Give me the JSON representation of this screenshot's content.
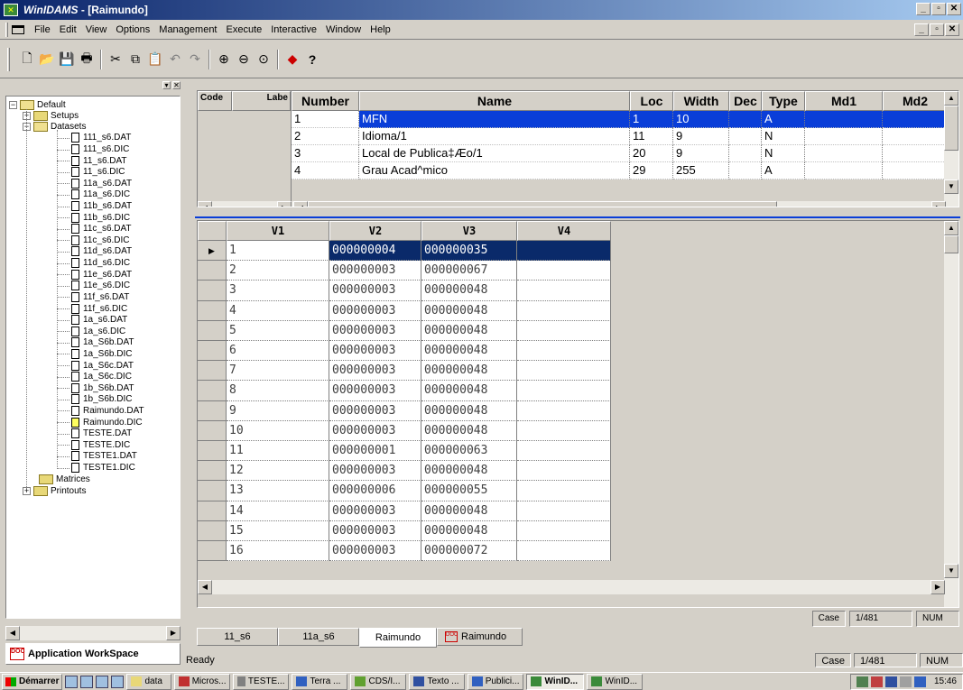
{
  "window": {
    "title_app": "WinIDAMS",
    "title_doc": " - [Raimundo]"
  },
  "menu": [
    "File",
    "Edit",
    "View",
    "Options",
    "Management",
    "Execute",
    "Interactive",
    "Window",
    "Help"
  ],
  "toolbar": [
    "new-icon",
    "open-icon",
    "save-icon",
    "print-icon",
    "cut-icon",
    "copy-icon",
    "paste-icon",
    "undo-icon",
    "redo-icon",
    "zoom-in-icon",
    "zoom-out-icon",
    "zoom-reset-icon",
    "diamond-icon",
    "help-icon"
  ],
  "tree": {
    "root": "Default",
    "setups": "Setups",
    "datasets": "Datasets",
    "files": [
      "111_s6.DAT",
      "111_s6.DIC",
      "11_s6.DAT",
      "11_s6.DIC",
      "11a_s6.DAT",
      "11a_s6.DIC",
      "11b_s6.DAT",
      "11b_s6.DIC",
      "11c_s6.DAT",
      "11c_s6.DIC",
      "11d_s6.DAT",
      "11d_s6.DIC",
      "11e_s6.DAT",
      "11e_s6.DIC",
      "11f_s6.DAT",
      "11f_s6.DIC",
      "1a_s6.DAT",
      "1a_s6.DIC",
      "1a_S6b.DAT",
      "1a_S6b.DIC",
      "1a_S6c.DAT",
      "1a_S6c.DIC",
      "1b_S6b.DAT",
      "1b_S6b.DIC",
      "Raimundo.DAT",
      "Raimundo.DIC",
      "TESTE.DAT",
      "TESTE.DIC",
      "TESTE1.DAT",
      "TESTE1.DIC"
    ],
    "matrices": "Matrices",
    "printouts": "Printouts"
  },
  "app_workspace": "Application WorkSpace",
  "var_table": {
    "code_header": "Code",
    "label_header": "Labe",
    "headers": [
      "Number",
      "Name",
      "Loc",
      "Width",
      "Dec",
      "Type",
      "Md1",
      "Md2"
    ],
    "rows": [
      [
        "1",
        "MFN",
        "1",
        "10",
        "",
        "A",
        "",
        ""
      ],
      [
        "2",
        "Idioma/1",
        "11",
        "9",
        "",
        "N",
        "",
        ""
      ],
      [
        "3",
        "Local de Publica‡Æo/1",
        "20",
        "9",
        "",
        "N",
        "",
        ""
      ],
      [
        "4",
        "Grau Acad^mico",
        "29",
        "255",
        "",
        "A",
        "",
        ""
      ]
    ]
  },
  "data_grid": {
    "headers": [
      "V1",
      "V2",
      "V3",
      "V4"
    ],
    "rows": [
      [
        "1",
        "000000004",
        "000000035",
        ""
      ],
      [
        "2",
        "000000003",
        "000000067",
        ""
      ],
      [
        "3",
        "000000003",
        "000000048",
        ""
      ],
      [
        "4",
        "000000003",
        "000000048",
        ""
      ],
      [
        "5",
        "000000003",
        "000000048",
        ""
      ],
      [
        "6",
        "000000003",
        "000000048",
        ""
      ],
      [
        "7",
        "000000003",
        "000000048",
        ""
      ],
      [
        "8",
        "000000003",
        "000000048",
        ""
      ],
      [
        "9",
        "000000003",
        "000000048",
        ""
      ],
      [
        "10",
        "000000003",
        "000000048",
        ""
      ],
      [
        "11",
        "000000001",
        "000000063",
        ""
      ],
      [
        "12",
        "000000003",
        "000000048",
        ""
      ],
      [
        "13",
        "000000006",
        "000000055",
        ""
      ],
      [
        "14",
        "000000003",
        "000000048",
        ""
      ],
      [
        "15",
        "000000003",
        "000000048",
        ""
      ],
      [
        "16",
        "000000003",
        "000000072",
        ""
      ]
    ],
    "current_row_marker": "▶"
  },
  "inner_status": {
    "case_label": "Case",
    "case_value": "1/481",
    "num": "NUM"
  },
  "tabs": [
    "11_s6",
    "11a_s6",
    "Raimundo",
    "Raimundo"
  ],
  "status": {
    "ready": "Ready",
    "case_label": "Case",
    "case_value": "1/481",
    "num": "NUM"
  },
  "taskbar": {
    "start": "Démarrer",
    "tasks": [
      "data",
      "Micros...",
      "TESTE...",
      "Terra ...",
      "CDS/I...",
      "Texto ...",
      "Publici...",
      "WinID...",
      "WinID..."
    ],
    "clock": "15:46"
  }
}
